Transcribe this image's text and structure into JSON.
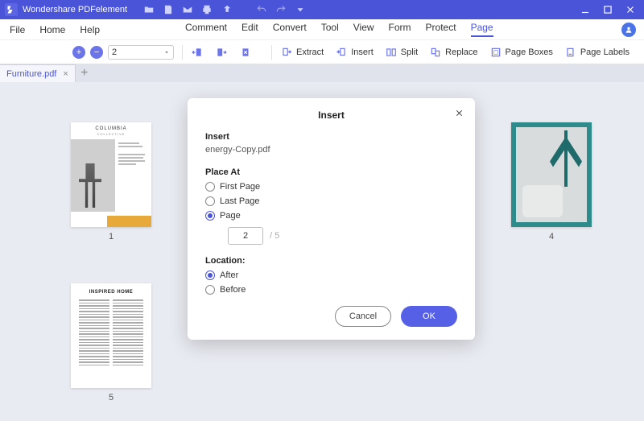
{
  "app": {
    "title": "Wondershare PDFelement"
  },
  "menus": {
    "file": "File",
    "home": "Home",
    "help": "Help",
    "comment": "Comment",
    "edit": "Edit",
    "convert": "Convert",
    "tool": "Tool",
    "view": "View",
    "form": "Form",
    "protect": "Protect",
    "page": "Page"
  },
  "toolbar": {
    "page_value": "2",
    "extract": "Extract",
    "insert": "Insert",
    "split": "Split",
    "replace": "Replace",
    "pageboxes": "Page Boxes",
    "pagelabels": "Page Labels"
  },
  "tab": {
    "filename": "Furniture.pdf"
  },
  "thumbs": {
    "p1": {
      "label": "1",
      "title1": "COLUMBIA",
      "title2": "COLLECTIVE"
    },
    "p4": {
      "label": "4"
    },
    "p5": {
      "label": "5",
      "title": "INSPIRED HOME"
    }
  },
  "dialog": {
    "title": "Insert",
    "section_insert": "Insert",
    "filename": "energy-Copy.pdf",
    "section_placeat": "Place At",
    "opt_first": "First Page",
    "opt_last": "Last Page",
    "opt_page": "Page",
    "page_value": "2",
    "page_total": "/  5",
    "section_location": "Location:",
    "opt_after": "After",
    "opt_before": "Before",
    "btn_cancel": "Cancel",
    "btn_ok": "OK"
  }
}
